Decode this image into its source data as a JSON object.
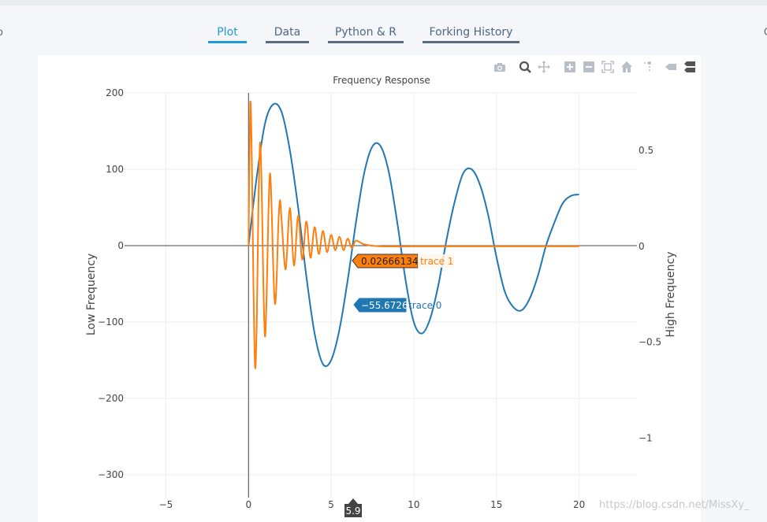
{
  "tabs": [
    {
      "label": "Plot",
      "active": true
    },
    {
      "label": "Data",
      "active": false
    },
    {
      "label": "Python & R",
      "active": false
    },
    {
      "label": "Forking History",
      "active": false
    }
  ],
  "edge_left": "o",
  "edge_right": "C",
  "modebar": {
    "icons": [
      "camera-icon",
      "zoom-icon",
      "pan-icon",
      "zoom-in-icon",
      "zoom-out-icon",
      "autoscale-icon",
      "reset-axes-icon",
      "spike-lines-icon",
      "hover-closest-icon",
      "hover-compare-icon"
    ]
  },
  "chart_data": {
    "type": "line",
    "title": "Frequency Response",
    "xlabel": "",
    "ylabel": "Low Frequency",
    "y2label": "High Frequency",
    "xlim": [
      -7.5,
      23.5
    ],
    "ylim": [
      -330,
      200
    ],
    "y2lim": [
      -1.31,
      0.8
    ],
    "xticks": [
      "−5",
      "0",
      "5",
      "10",
      "15",
      "20"
    ],
    "yticks": [
      "200",
      "100",
      "0",
      "−100",
      "−200",
      "−300"
    ],
    "y2ticks": [
      "0.5",
      "0",
      "−0.5",
      "−1"
    ],
    "grid": true,
    "colors": {
      "trace0": "#1f77b4",
      "trace1": "#ff7f0e"
    },
    "series": [
      {
        "name": "trace 0",
        "axis": "y",
        "x": [
          0,
          0.5,
          1,
          1.5,
          2,
          2.5,
          3,
          3.5,
          4,
          4.5,
          5,
          5.5,
          6,
          6.5,
          7,
          7.5,
          8,
          8.5,
          9,
          9.5,
          10,
          10.5,
          11,
          11.5,
          12,
          12.5,
          13,
          13.5,
          14,
          14.5,
          15,
          15.5,
          16,
          16.5,
          17,
          17.5,
          18,
          18.5,
          19,
          19.5,
          20
        ],
        "y": [
          0,
          90,
          160,
          185,
          175,
          125,
          50,
          -40,
          -115,
          -155,
          -150,
          -110,
          -45,
          30,
          95,
          130,
          130,
          95,
          30,
          -45,
          -100,
          -115,
          -95,
          -50,
          10,
          60,
          95,
          100,
          80,
          40,
          -15,
          -60,
          -80,
          -85,
          -70,
          -40,
          0,
          30,
          55,
          65,
          67
        ]
      },
      {
        "name": "trace 1",
        "axis": "y2",
        "x": [
          0,
          0.1,
          0.2,
          0.3,
          0.4,
          0.5,
          0.6,
          0.7,
          0.8,
          0.9,
          1.0,
          1.1,
          1.2,
          1.3,
          1.4,
          1.5,
          1.6,
          1.7,
          1.8,
          1.9,
          2.0,
          2.25,
          2.5,
          2.75,
          3.0,
          3.25,
          3.5,
          3.75,
          4.0,
          4.25,
          4.5,
          4.75,
          5.0,
          5.25,
          5.5,
          5.75,
          6.0,
          6.25,
          6.5,
          7,
          8,
          10,
          12,
          14,
          16,
          18,
          20
        ],
        "y": [
          0,
          0.74,
          0.45,
          -0.2,
          -0.63,
          -0.4,
          0.2,
          0.54,
          0.3,
          -0.2,
          -0.47,
          -0.25,
          0.15,
          0.38,
          0.2,
          -0.12,
          -0.3,
          -0.18,
          0.1,
          0.24,
          0.14,
          -0.12,
          0.2,
          -0.1,
          0.16,
          -0.07,
          0.13,
          -0.06,
          0.1,
          -0.04,
          0.08,
          -0.03,
          0.06,
          -0.02,
          0.05,
          -0.02,
          0.04,
          -0.01,
          0.03,
          0.01,
          0,
          0,
          0,
          0,
          0,
          0,
          0
        ]
      }
    ],
    "hover": {
      "x_label": "5.9",
      "points": [
        {
          "trace": "trace 1",
          "value": "0.02666134",
          "label": "trace 1"
        },
        {
          "trace": "trace 0",
          "value": "−55.6726",
          "label": "trace 0"
        }
      ]
    }
  },
  "watermark": "https://blog.csdn.net/MissXy_"
}
